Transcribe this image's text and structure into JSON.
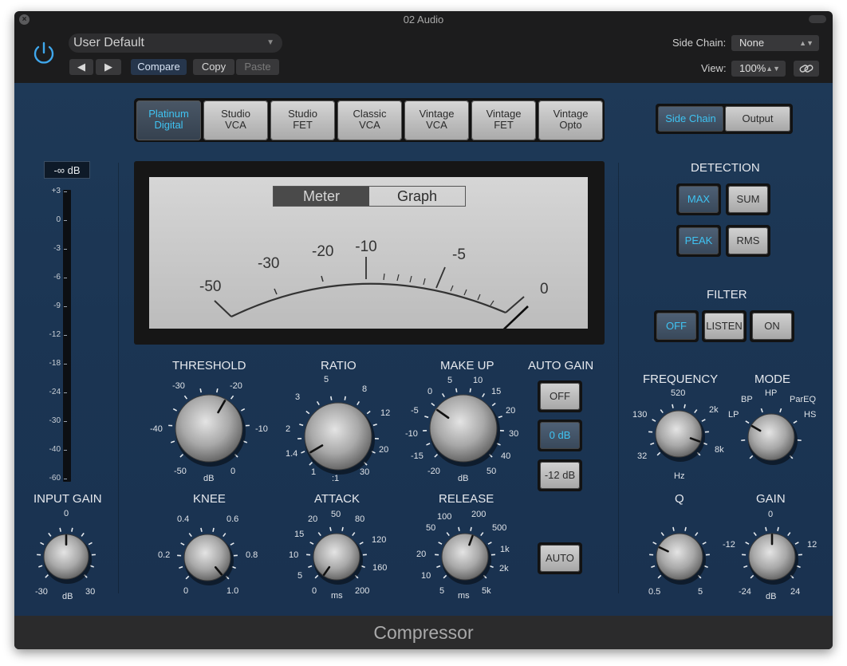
{
  "window": {
    "title": "02 Audio"
  },
  "header": {
    "preset": "User Default",
    "prev_label": "◀",
    "next_label": "▶",
    "compare_label": "Compare",
    "copy_label": "Copy",
    "paste_label": "Paste",
    "side_chain_label": "Side Chain:",
    "side_chain_value": "None",
    "view_label": "View:",
    "view_value": "100%"
  },
  "models": [
    {
      "l1": "Platinum",
      "l2": "Digital",
      "active": true
    },
    {
      "l1": "Studio",
      "l2": "VCA"
    },
    {
      "l1": "Studio",
      "l2": "FET"
    },
    {
      "l1": "Classic",
      "l2": "VCA"
    },
    {
      "l1": "Vintage",
      "l2": "VCA"
    },
    {
      "l1": "Vintage",
      "l2": "FET"
    },
    {
      "l1": "Vintage",
      "l2": "Opto"
    }
  ],
  "view_toggle": {
    "side_chain": "Side Chain",
    "output": "Output"
  },
  "meter": {
    "tab_meter": "Meter",
    "tab_graph": "Graph",
    "scale": [
      "-50",
      "-30",
      "-20",
      "-10",
      "-5",
      "0"
    ]
  },
  "input": {
    "readout": "-∞ dB",
    "ticks": [
      "+3",
      "0",
      "-3",
      "-6",
      "-9",
      "-12",
      "-18",
      "-24",
      "-30",
      "-40",
      "-60"
    ],
    "gain_label": "INPUT GAIN",
    "gain_top": "0",
    "gain_min": "-30",
    "gain_unit": "dB",
    "gain_max": "30"
  },
  "threshold": {
    "label": "THRESHOLD",
    "s1": "-30",
    "s2": "-20",
    "s3": "-40",
    "s4": "-10",
    "s5": "-50",
    "s6": "dB",
    "s7": "0"
  },
  "ratio": {
    "label": "RATIO",
    "s1": "5",
    "s2": "3",
    "s3": "8",
    "s4": "12",
    "s5": "2",
    "s6": "1.4",
    "s7": "20",
    "s8": "1",
    "s9": ":1",
    "s10": "30"
  },
  "makeup": {
    "label": "MAKE UP",
    "s1": "5",
    "s2": "10",
    "s3": "0",
    "s4": "15",
    "s5": "-5",
    "s6": "20",
    "s7": "-10",
    "s8": "30",
    "s9": "-15",
    "s10": "40",
    "s11": "-20",
    "s12": "dB",
    "s13": "50"
  },
  "auto_gain": {
    "label": "AUTO GAIN",
    "off": "OFF",
    "zero": "0 dB",
    "minus12": "-12 dB"
  },
  "knee": {
    "label": "KNEE",
    "s1": "0.4",
    "s2": "0.6",
    "s3": "0.2",
    "s4": "0.8",
    "s5": "0",
    "s6": "1.0"
  },
  "attack": {
    "label": "ATTACK",
    "s1": "20",
    "s2": "50",
    "s3": "80",
    "s4": "15",
    "s5": "120",
    "s6": "10",
    "s7": "5",
    "s8": "160",
    "s9": "0",
    "s10": "ms",
    "s11": "200"
  },
  "release": {
    "label": "RELEASE",
    "s1": "100",
    "s2": "200",
    "s3": "50",
    "s4": "500",
    "s5": "1k",
    "s6": "20",
    "s7": "2k",
    "s8": "10",
    "s9": "5",
    "s10": "ms",
    "s11": "5k",
    "auto": "AUTO"
  },
  "detection": {
    "label": "DETECTION",
    "max": "MAX",
    "sum": "SUM",
    "peak": "PEAK",
    "rms": "RMS"
  },
  "filter": {
    "label": "FILTER",
    "off": "OFF",
    "listen": "LISTEN",
    "on": "ON"
  },
  "frequency": {
    "label": "FREQUENCY",
    "s1": "520",
    "s2": "130",
    "s3": "2k",
    "s4": "32",
    "s5": "8k",
    "s6": "Hz"
  },
  "mode": {
    "label": "MODE",
    "s1": "HP",
    "s2": "BP",
    "s3": "ParEQ",
    "s4": "LP",
    "s5": "HS"
  },
  "q": {
    "label": "Q",
    "min": "0.5",
    "max": "5"
  },
  "gain": {
    "label": "GAIN",
    "top": "0",
    "left": "-12",
    "right": "12",
    "min": "-24",
    "unit": "dB",
    "max": "24"
  },
  "footer": {
    "title": "Compressor"
  },
  "colors": {
    "accent": "#3fc3f2",
    "panel": "#1b3553"
  }
}
